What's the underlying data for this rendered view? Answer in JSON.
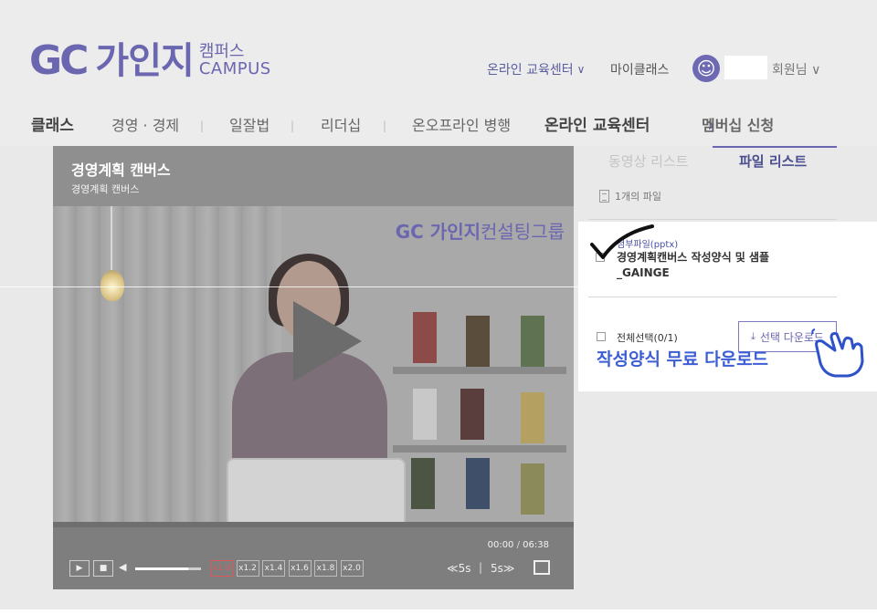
{
  "header": {
    "logo_mark": "GC",
    "logo_name": "가인지",
    "logo_sub_ko": "캠퍼스",
    "logo_sub_en": "CAMPUS",
    "online_edu": "온라인 교육센터",
    "my_class": "마이클래스",
    "member_label": "회원님"
  },
  "nav": {
    "items": [
      "클래스",
      "경영 · 경제",
      "일잘법",
      "리더십",
      "온오프라인 병행",
      "온라인 교육센터",
      "멤버십 신청"
    ],
    "separator": "|",
    "cta_arrow": "›"
  },
  "player": {
    "title": "경영계획 캔버스",
    "subtitle": "경영계획 캔버스",
    "watermark_brand": "GC 가인지",
    "watermark_sub": "컨설팅그룹",
    "time_current": "00:00",
    "time_separator": "/",
    "time_total": "06:38",
    "progress": 0.0,
    "volume": 0.8,
    "speeds": [
      "x1.0",
      "x1.2",
      "x1.4",
      "x1.6",
      "x1.8",
      "x2.0"
    ],
    "active_speed": "x1.0",
    "skip_back": "≪5s",
    "skip_forward": "5s≫",
    "skip_separator": "|"
  },
  "panel": {
    "tab_video": "동영상 리스트",
    "tab_file": "파일 리스트",
    "file_count": "1개의 파일",
    "file_type": "첨부파일(pptx)",
    "file_name_line1": "경영계획캔버스 작성양식 및 샘플",
    "file_name_line2": "_GAINGE",
    "select_all": "전체선택(0/1)",
    "download_button": "선택 다운로드",
    "promo_text": "작성양식 무료 다운로드"
  },
  "colors": {
    "brand": "#6b66b0",
    "promo_blue": "#3d5ed4",
    "active_speed": "#e05858"
  }
}
